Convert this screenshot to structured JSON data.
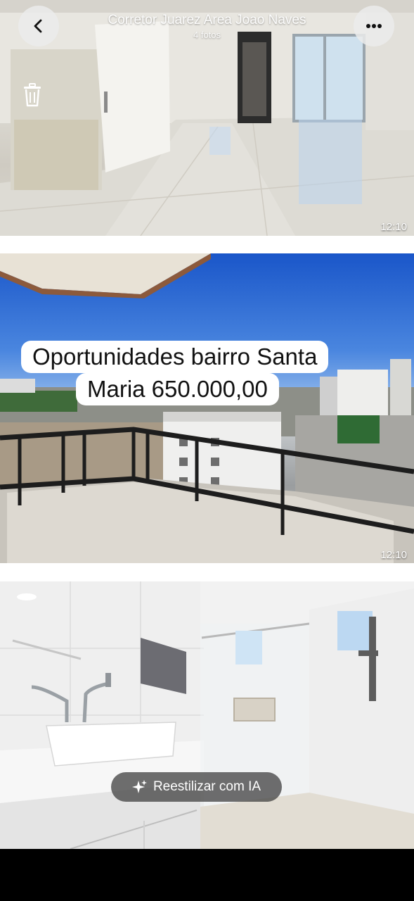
{
  "header": {
    "title": "Corretor Juarez Area Joao Naves",
    "subtitle": "4 fotos",
    "back_icon": "chevron-left-icon",
    "more_icon": "ellipsis-icon",
    "trash_icon": "trash-icon"
  },
  "photos": [
    {
      "time": "12:10"
    },
    {
      "time": "12:10",
      "overlay_lines": [
        "Oportunidades bairro Santa",
        "Maria 650.000,00"
      ]
    },
    {
      "time": ""
    }
  ],
  "ai_button": {
    "label": "Reestilizar com IA",
    "icon": "sparkles-icon"
  }
}
